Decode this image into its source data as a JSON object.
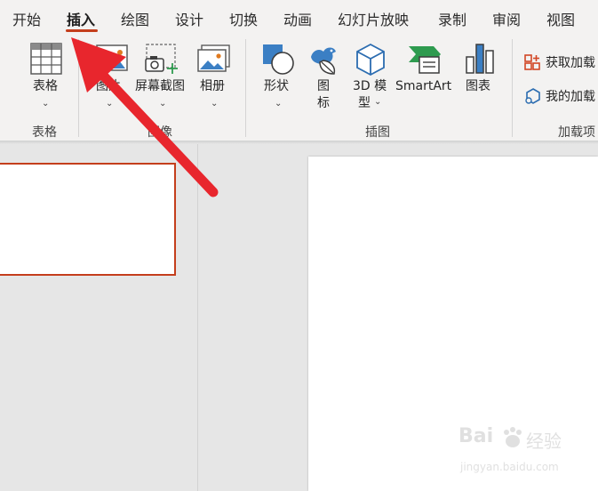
{
  "tabs": [
    {
      "label": "开始"
    },
    {
      "label": "插入",
      "active": true
    },
    {
      "label": "绘图"
    },
    {
      "label": "设计"
    },
    {
      "label": "切换"
    },
    {
      "label": "动画"
    },
    {
      "label": "幻灯片放映"
    },
    {
      "label": "录制"
    },
    {
      "label": "审阅"
    },
    {
      "label": "视图"
    }
  ],
  "ribbon": {
    "groups": {
      "tables": "表格",
      "images": "图像",
      "illustrations": "插图",
      "addins": "加载项"
    },
    "buttons": {
      "table": "表格",
      "pictures": "图片",
      "screenshot": "屏幕截图",
      "album": "相册",
      "shapes": "形状",
      "icons_line1": "图",
      "icons_line2": "标",
      "model3d_line1": "3D 模",
      "model3d_line2": "型",
      "smartart": "SmartArt",
      "chart": "图表",
      "get_addins": "获取加载",
      "my_addins": "我的加载"
    }
  },
  "watermark": {
    "brand": "Bai",
    "brand_tail": "经验",
    "url": "jingyan.baidu.com"
  },
  "colors": {
    "accent": "#c43e1c",
    "arrow": "#e8262d",
    "icon_blue": "#2b6cb0",
    "ribbon_bg": "#f3f2f1"
  }
}
